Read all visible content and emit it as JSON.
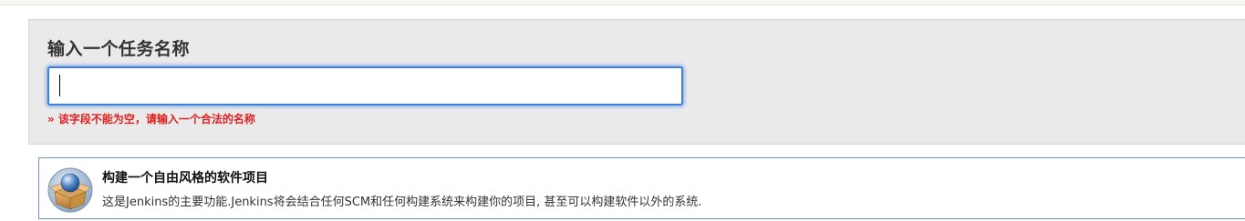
{
  "new_item_form": {
    "heading": "输入一个任务名称",
    "name_input": {
      "value": "",
      "placeholder": ""
    },
    "validation_message": "» 该字段不能为空，请输入一个合法的名称"
  },
  "job_types": [
    {
      "icon": "freestyle-project-icon",
      "title": "构建一个自由风格的软件项目",
      "description": "这是Jenkins的主要功能.Jenkins将会结合任何SCM和任何构建系统来构建你的项目, 甚至可以构建软件以外的系统."
    }
  ],
  "colors": {
    "panel_bg": "#eaeaea",
    "focus_border": "#3f7fdc",
    "error_text": "#e02020",
    "item_border": "#6f95c5"
  }
}
